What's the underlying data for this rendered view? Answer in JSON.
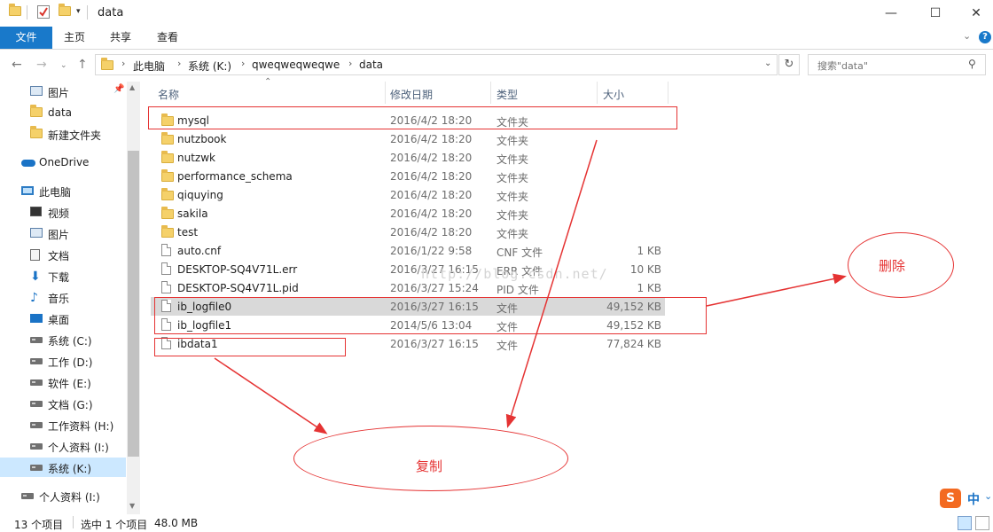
{
  "window": {
    "title": "data",
    "minimize": "—",
    "maximize": "☐",
    "close": "✕"
  },
  "ribbon": {
    "tabs": [
      "文件",
      "主页",
      "共享",
      "查看"
    ]
  },
  "address": {
    "crumbs": [
      "此电脑",
      "系统 (K:)",
      "qweqweqweqwe",
      "data"
    ],
    "search_placeholder": "搜索\"data\""
  },
  "nav": {
    "items": [
      {
        "label": "图片",
        "icon": "pictures-icon"
      },
      {
        "label": "data",
        "icon": "folder-icon"
      },
      {
        "label": "新建文件夹",
        "icon": "folder-icon"
      },
      {
        "label": "OneDrive",
        "icon": "onedrive-icon"
      },
      {
        "label": "此电脑",
        "icon": "this-pc-icon"
      },
      {
        "label": "视频",
        "icon": "videos-icon"
      },
      {
        "label": "图片",
        "icon": "pictures-icon"
      },
      {
        "label": "文档",
        "icon": "documents-icon"
      },
      {
        "label": "下载",
        "icon": "downloads-icon"
      },
      {
        "label": "音乐",
        "icon": "music-icon"
      },
      {
        "label": "桌面",
        "icon": "desktop-icon"
      },
      {
        "label": "系统 (C:)",
        "icon": "drive-icon"
      },
      {
        "label": "工作 (D:)",
        "icon": "drive-icon"
      },
      {
        "label": "软件 (E:)",
        "icon": "drive-icon"
      },
      {
        "label": "文档 (G:)",
        "icon": "drive-icon"
      },
      {
        "label": "工作资料 (H:)",
        "icon": "drive-icon"
      },
      {
        "label": "个人资料 (I:)",
        "icon": "drive-icon"
      },
      {
        "label": "系统 (K:)",
        "icon": "drive-icon"
      },
      {
        "label": "个人资料 (I:)",
        "icon": "drive-icon"
      }
    ]
  },
  "columns": {
    "name": "名称",
    "date": "修改日期",
    "type": "类型",
    "size": "大小"
  },
  "files": [
    {
      "name": "mysql",
      "date": "2016/4/2 18:20",
      "type": "文件夹",
      "size": "",
      "kind": "folder"
    },
    {
      "name": "nutzbook",
      "date": "2016/4/2 18:20",
      "type": "文件夹",
      "size": "",
      "kind": "folder"
    },
    {
      "name": "nutzwk",
      "date": "2016/4/2 18:20",
      "type": "文件夹",
      "size": "",
      "kind": "folder"
    },
    {
      "name": "performance_schema",
      "date": "2016/4/2 18:20",
      "type": "文件夹",
      "size": "",
      "kind": "folder"
    },
    {
      "name": "qiquying",
      "date": "2016/4/2 18:20",
      "type": "文件夹",
      "size": "",
      "kind": "folder"
    },
    {
      "name": "sakila",
      "date": "2016/4/2 18:20",
      "type": "文件夹",
      "size": "",
      "kind": "folder"
    },
    {
      "name": "test",
      "date": "2016/4/2 18:20",
      "type": "文件夹",
      "size": "",
      "kind": "folder"
    },
    {
      "name": "auto.cnf",
      "date": "2016/1/22 9:58",
      "type": "CNF 文件",
      "size": "1 KB",
      "kind": "file"
    },
    {
      "name": "DESKTOP-SQ4V71L.err",
      "date": "2016/3/27 16:15",
      "type": "ERR 文件",
      "size": "10 KB",
      "kind": "file"
    },
    {
      "name": "DESKTOP-SQ4V71L.pid",
      "date": "2016/3/27 15:24",
      "type": "PID 文件",
      "size": "1 KB",
      "kind": "file"
    },
    {
      "name": "ib_logfile0",
      "date": "2016/3/27 16:15",
      "type": "文件",
      "size": "49,152 KB",
      "kind": "file"
    },
    {
      "name": "ib_logfile1",
      "date": "2014/5/6 13:04",
      "type": "文件",
      "size": "49,152 KB",
      "kind": "file"
    },
    {
      "name": "ibdata1",
      "date": "2016/3/27 16:15",
      "type": "文件",
      "size": "77,824 KB",
      "kind": "file"
    }
  ],
  "status": {
    "count": "13 个项目",
    "selection": "选中 1 个项目",
    "size": "48.0 MB"
  },
  "annotations": {
    "delete_label": "删除",
    "copy_label": "复制",
    "watermark": "http://blog.csdn.net/"
  },
  "ime": {
    "logo": "S",
    "mode": "中"
  },
  "colors": {
    "accent": "#1979ca",
    "annotation": "#e53333",
    "selection": "#d9d9d9"
  }
}
